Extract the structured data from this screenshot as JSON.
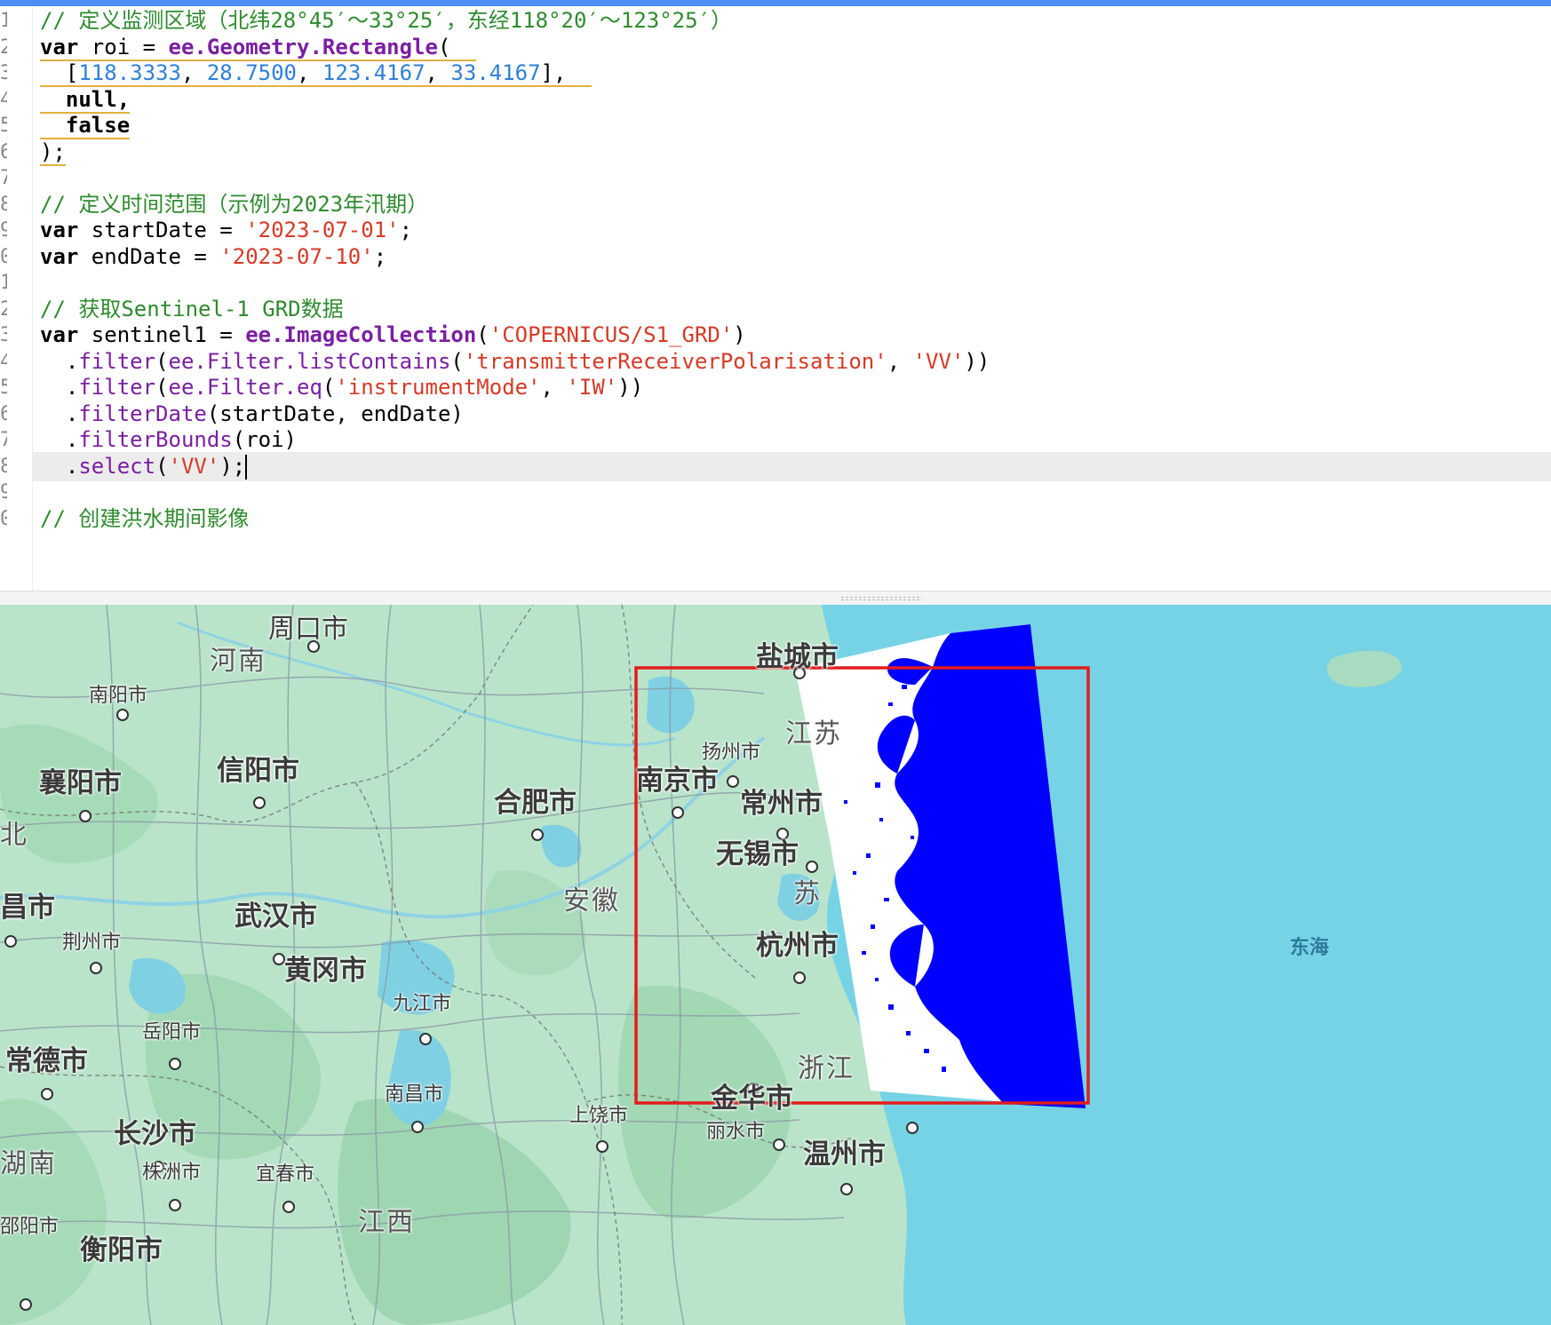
{
  "editor": {
    "line_numbers": [
      "1",
      "2",
      "3",
      "4",
      "5",
      "6",
      "7",
      "8",
      "9",
      "0",
      "1",
      "2",
      "3",
      "4",
      "5",
      "6",
      "7",
      "8",
      "9",
      "0"
    ],
    "code": {
      "l1_comment": "// 定义监测区域（北纬28°45′～33°25′，东经118°20′～123°25′）",
      "l2_kw": "var",
      "l2_name": " roi = ",
      "l2_fn": "ee.Geometry.Rectangle",
      "l2_paren": "(",
      "l3_open": "  [",
      "l3_n1": "118.3333",
      "l3_n2": "28.7500",
      "l3_n3": "123.4167",
      "l3_n4": "33.4167",
      "l3_close": "],",
      "comma_sep": ", ",
      "l4": "  null,",
      "l5": "  false",
      "l6": ");",
      "l8_comment": "// 定义时间范围（示例为2023年汛期）",
      "l9_kw": "var",
      "l9_name": " startDate = ",
      "l9_str": "'2023-07-01'",
      "l10_kw": "var",
      "l10_name": " endDate = ",
      "l10_str": "'2023-07-10'",
      "semi": ";",
      "l12_comment": "// 获取Sentinel-1 GRD数据",
      "l13_kw": "var",
      "l13_name": " sentinel1 = ",
      "l13_fn": "ee.ImageCollection",
      "l13_open": "(",
      "l13_str": "'COPERNICUS/S1_GRD'",
      "l13_close": ")",
      "l14_dot": "  .",
      "l14_mth": "filter",
      "l14_open": "(",
      "l14_fn": "ee.Filter.listContains",
      "l14_open2": "(",
      "l14_str1": "'transmitterReceiverPolarisation'",
      "l14_sep": ", ",
      "l14_str2": "'VV'",
      "l14_close": "))",
      "l15_dot": "  .",
      "l15_mth": "filter",
      "l15_open": "(",
      "l15_fn": "ee.Filter.eq",
      "l15_open2": "(",
      "l15_str1": "'instrumentMode'",
      "l15_sep": ", ",
      "l15_str2": "'IW'",
      "l15_close": "))",
      "l16_dot": "  .",
      "l16_mth": "filterDate",
      "l16_args": "(startDate, endDate)",
      "l17_dot": "  .",
      "l17_mth": "filterBounds",
      "l17_args": "(roi)",
      "l18_dot": "  .",
      "l18_mth": "select",
      "l18_open": "(",
      "l18_str": "'VV'",
      "l18_close": ");",
      "l20_comment": "// 创建洪水期间影像"
    }
  },
  "map": {
    "colors": {
      "land": "#b8e3c9",
      "sea": "#76d3e6",
      "roi_border": "#e31b1b",
      "water_pixels": "#0000ff",
      "nonwater_pixels": "#ffffff"
    },
    "cities": {
      "zhoukou": "周口市",
      "henan": "河南",
      "nanyang": "南阳市",
      "xiangyang": "襄阳市",
      "xinyang": "信阳市",
      "hefei": "合肥市",
      "yancheng": "盐城市",
      "jiangsu": "江苏",
      "yangzhou": "扬州市",
      "nanjing": "南京市",
      "changzhou": "常州市",
      "wuxi": "无锡市",
      "su": "苏",
      "anhui": "安徽",
      "hubei_bei": "北",
      "yichang": "昌市",
      "jingzhou": "荆州市",
      "wuhan": "武汉市",
      "huanggang": "黄冈市",
      "hangzhou": "杭州市",
      "jiujiang": "九江市",
      "yueyang": "岳阳市",
      "changde": "常德市",
      "zhejiang": "浙江",
      "nanchang": "南昌市",
      "shangrao": "上饶市",
      "jinhua": "金华市",
      "lishui": "丽水市",
      "wenzhou": "温州市",
      "changsha": "长沙市",
      "hunan": "湖南",
      "zhuzhou": "株洲市",
      "yichun": "宜春市",
      "jiangxi": "江西",
      "shaoyang": "邵阳市",
      "hengyang": "衡阳市",
      "donghai": "东海"
    }
  }
}
